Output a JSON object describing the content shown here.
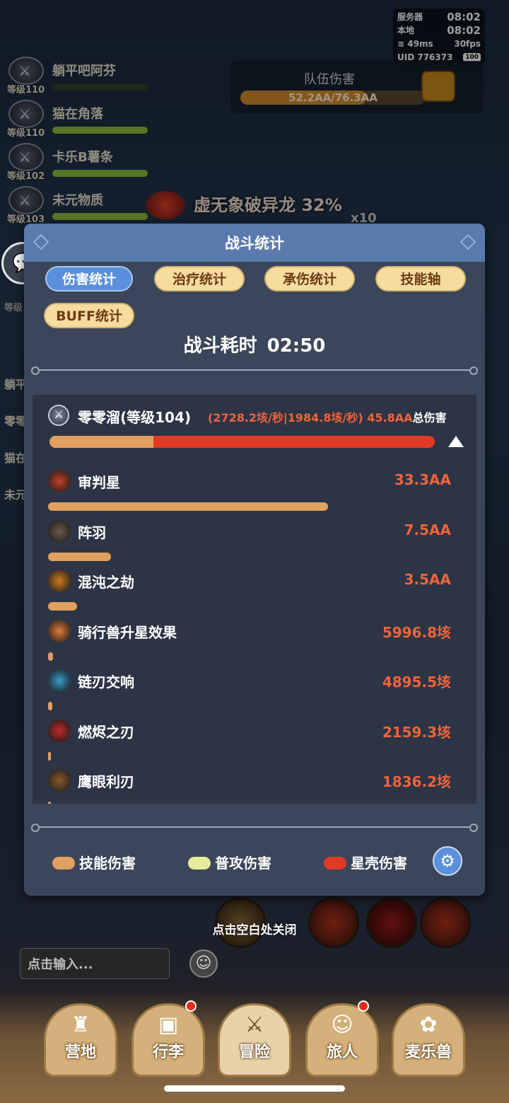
{
  "status": {
    "server_label": "服务器",
    "server_time": "08:02",
    "local_label": "本地",
    "local_time": "08:02",
    "ping": "49ms",
    "fps": "30fps",
    "uid": "UID 776373",
    "battery": "100"
  },
  "party": [
    {
      "name": "躺平吧阿芬",
      "level": "等级110",
      "icon": "crossed-swords-icon",
      "hp": 0
    },
    {
      "name": "猫在角落",
      "level": "等级110",
      "icon": "star-emblem-icon",
      "hp": 1
    },
    {
      "name": "卡乐B薯条",
      "level": "等级102",
      "icon": "bow-icon",
      "hp": 1
    },
    {
      "name": "未元物质",
      "level": "等级103",
      "icon": "crossed-swords-icon",
      "hp": 1
    }
  ],
  "side_names": [
    "躺平",
    "零零",
    "猫在",
    "未元"
  ],
  "side_level": "等级",
  "team_damage": {
    "title": "队伍伤害",
    "value": "52.2AA/76.3AA"
  },
  "boss": {
    "name": "虚无象破异龙 32%",
    "multiplier": "x10"
  },
  "modal": {
    "title": "战斗统计",
    "tabs": [
      "伤害统计",
      "治疗统计",
      "承伤统计",
      "技能轴",
      "BUFF统计"
    ],
    "active_tab": "伤害统计",
    "duration_label": "战斗耗时",
    "duration": "02:50",
    "hero": {
      "name": "零零溜(等级104)",
      "stats": "(2728.2垓/秒|1984.8垓/秒)",
      "total": "45.8AA",
      "total_suffix": "总伤害",
      "skill_ratio": 0.27
    },
    "skills": [
      {
        "name": "审判星",
        "value": "33.3AA",
        "ratio": 0.727,
        "icon_color": "#c0402a"
      },
      {
        "name": "阵羽",
        "value": "7.5AA",
        "ratio": 0.164,
        "icon_color": "#6a5a4a"
      },
      {
        "name": "混沌之劫",
        "value": "3.5AA",
        "ratio": 0.076,
        "icon_color": "#d07a20"
      },
      {
        "name": "骑行兽升星效果",
        "value": "5996.8垓",
        "ratio": 0.013,
        "icon_color": "#e07a3a"
      },
      {
        "name": "链刃交响",
        "value": "4895.5垓",
        "ratio": 0.011,
        "icon_color": "#3a9ac8"
      },
      {
        "name": "燃烬之刃",
        "value": "2159.3垓",
        "ratio": 0.005,
        "icon_color": "#c02a2a"
      },
      {
        "name": "鹰眼利刃",
        "value": "1836.2垓",
        "ratio": 0.004,
        "icon_color": "#8a5a2a"
      }
    ],
    "legend": [
      {
        "label": "技能伤害",
        "color": "#e0a060"
      },
      {
        "label": "普攻伤害",
        "color": "#e6ec9a"
      },
      {
        "label": "星壳伤害",
        "color": "#e03a24"
      }
    ]
  },
  "close_hint": "点击空白处关闭",
  "chat_input": {
    "placeholder": "点击输入..."
  },
  "nav": [
    "营地",
    "行李",
    "冒险",
    "旅人",
    "麦乐兽"
  ],
  "nav_active": "冒险"
}
